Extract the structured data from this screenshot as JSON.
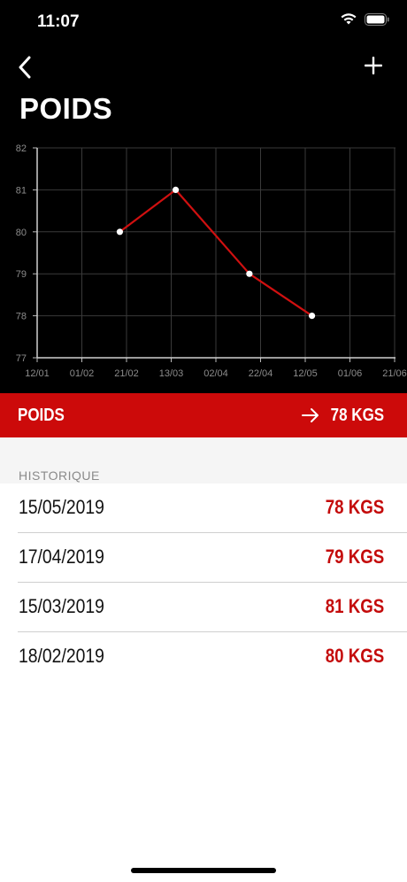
{
  "status_bar": {
    "time": "11:07"
  },
  "header": {
    "title": "POIDS"
  },
  "current": {
    "label": "POIDS",
    "value": "78 KGS"
  },
  "history": {
    "header": "HISTORIQUE",
    "items": [
      {
        "date": "15/05/2019",
        "value": "78 KGS"
      },
      {
        "date": "17/04/2019",
        "value": "79 KGS"
      },
      {
        "date": "15/03/2019",
        "value": "81 KGS"
      },
      {
        "date": "18/02/2019",
        "value": "80 KGS"
      }
    ]
  },
  "colors": {
    "accent": "#cc0a0a",
    "line": "#d01010",
    "background_top": "#000000"
  },
  "chart_data": {
    "type": "line",
    "x_ticks": [
      "12/01",
      "01/02",
      "21/02",
      "13/03",
      "02/04",
      "22/04",
      "12/05",
      "01/06",
      "21/06"
    ],
    "y_ticks": [
      "77",
      "78",
      "79",
      "80",
      "81",
      "82"
    ],
    "ylim": [
      77,
      82
    ],
    "grid": true,
    "series": [
      {
        "x": [
          "18/02/2019",
          "15/03/2019",
          "17/04/2019",
          "15/05/2019"
        ],
        "values": [
          80,
          81,
          79,
          78
        ]
      }
    ]
  }
}
